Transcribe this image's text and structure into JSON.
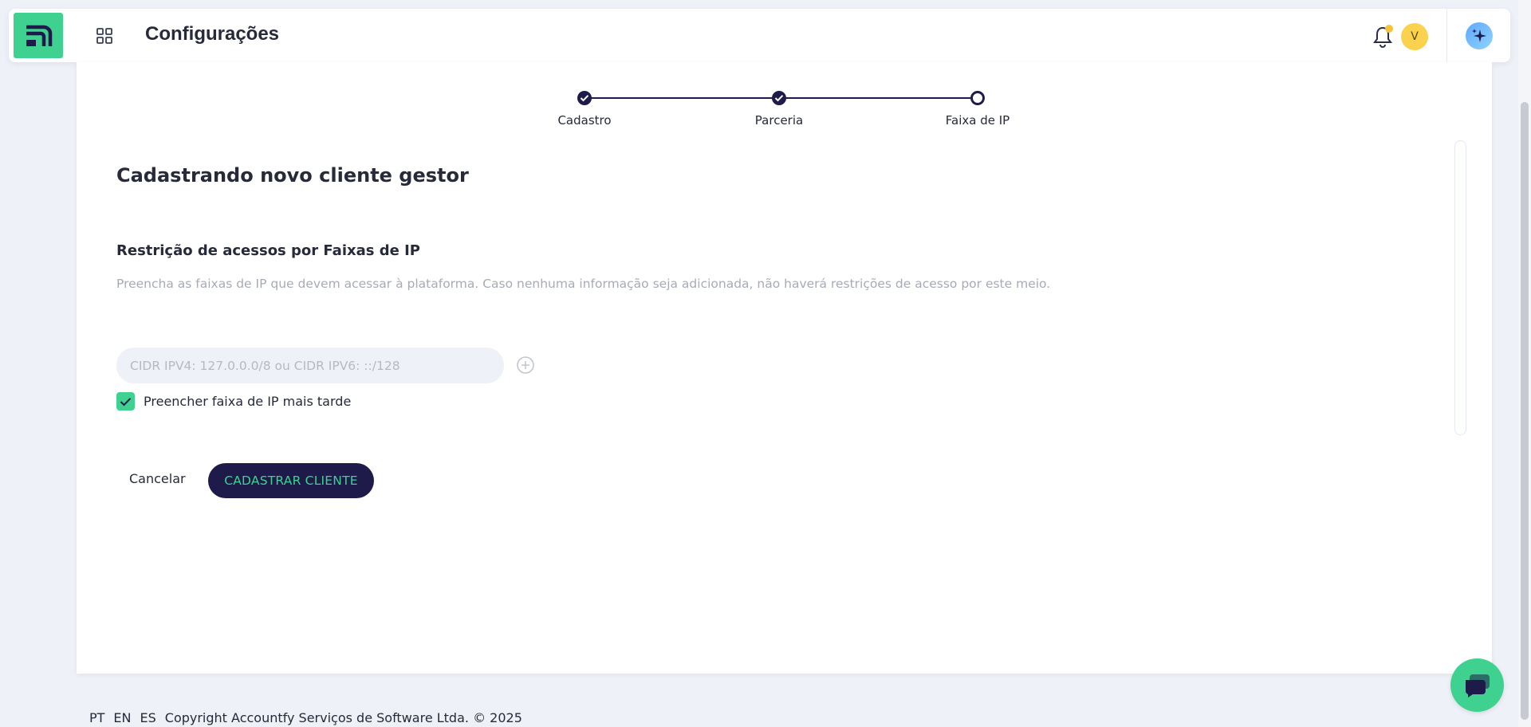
{
  "header": {
    "title": "Configurações",
    "avatar_initial": "V",
    "icons": {
      "logo": "app-logo",
      "apps": "grid-icon",
      "notifications": "bell-icon",
      "assistant": "sparkles-icon"
    }
  },
  "stepper": {
    "steps": [
      {
        "label": "Cadastro",
        "state": "done"
      },
      {
        "label": "Parceria",
        "state": "done"
      },
      {
        "label": "Faixa de IP",
        "state": "current"
      }
    ]
  },
  "form": {
    "heading": "Cadastrando novo cliente gestor",
    "section_title": "Restrição de acessos por Faixas de IP",
    "helper_text": "Preencha as faixas de IP que devem acessar à plataforma. Caso nenhuma informação seja adicionada, não haverá restrições de acesso por este meio.",
    "ip_input": {
      "value": "",
      "placeholder": "CIDR IPV4: 127.0.0.0/8 ou CIDR IPV6: ::/128"
    },
    "fill_later": {
      "checked": true,
      "label": "Preencher faixa de IP mais tarde"
    },
    "cancel_label": "Cancelar",
    "submit_label": "CADASTRAR CLIENTE"
  },
  "footer": {
    "languages": [
      "PT",
      "EN",
      "ES"
    ],
    "copyright": "Copyright Accountfy Serviços de Software Ltda. © 2025"
  },
  "colors": {
    "brand_green": "#3fd18f",
    "navy": "#1e1b4b",
    "page_background": "#eff1f8",
    "notification_dot": "#f5c23b",
    "avatar": "#fbd24e"
  }
}
